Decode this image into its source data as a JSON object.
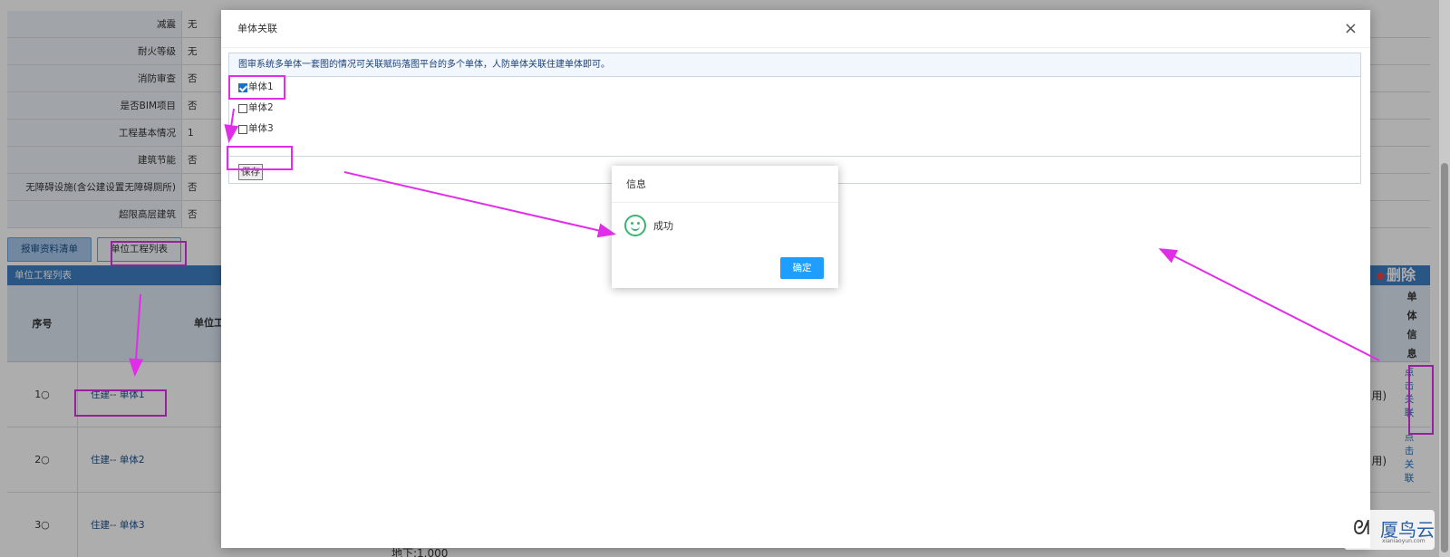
{
  "info_rows": [
    {
      "label": "减震",
      "value": "无"
    },
    {
      "label": "耐火等级",
      "value": "无"
    },
    {
      "label": "消防审查",
      "value": "否"
    },
    {
      "label": "是否BIM项目",
      "value": "否"
    },
    {
      "label": "工程基本情况",
      "value": "1"
    },
    {
      "label": "建筑节能",
      "value": "否"
    },
    {
      "label": "无障碍设施(含公建设置无障碍厕所)",
      "value": "否"
    },
    {
      "label": "超限高层建筑",
      "value": "否"
    }
  ],
  "tabs": [
    "报审资料清单",
    "单位工程列表"
  ],
  "unit_list": {
    "title": "单位工程列表",
    "delete_label": "删除",
    "col_no": "序号",
    "col_name": "单位工",
    "col_side": "单体信息",
    "rows": [
      {
        "no": "1",
        "name": "住建-- 单体1",
        "tail": "用)",
        "link": "点击关联"
      },
      {
        "no": "2",
        "name": "住建-- 单体2",
        "tail": "用)",
        "link": "点击关联"
      },
      {
        "no": "3",
        "name": "住建-- 单体3",
        "tail": "",
        "link": ""
      }
    ],
    "row_marker": "○",
    "bottom_fragment": "地下:1.000"
  },
  "modal": {
    "title": "单体关联",
    "close": "×",
    "note": "图审系统多单体一套图的情况可关联赋码落图平台的多个单体，人防单体关联住建单体即可。",
    "items": [
      {
        "label": "单体1",
        "checked": true
      },
      {
        "label": "单体2",
        "checked": false
      },
      {
        "label": "单体3",
        "checked": false
      }
    ],
    "save_label": "保存"
  },
  "dialog": {
    "title": "信息",
    "message": "成功",
    "ok_label": "确定",
    "icon": "smile-icon"
  },
  "watermark": {
    "name": "厦鸟云",
    "sub": "xianiaoyun.com"
  },
  "colors": {
    "highlight": "#e02ee8",
    "primary": "#1e9fff",
    "header": "#3f7fc5"
  }
}
